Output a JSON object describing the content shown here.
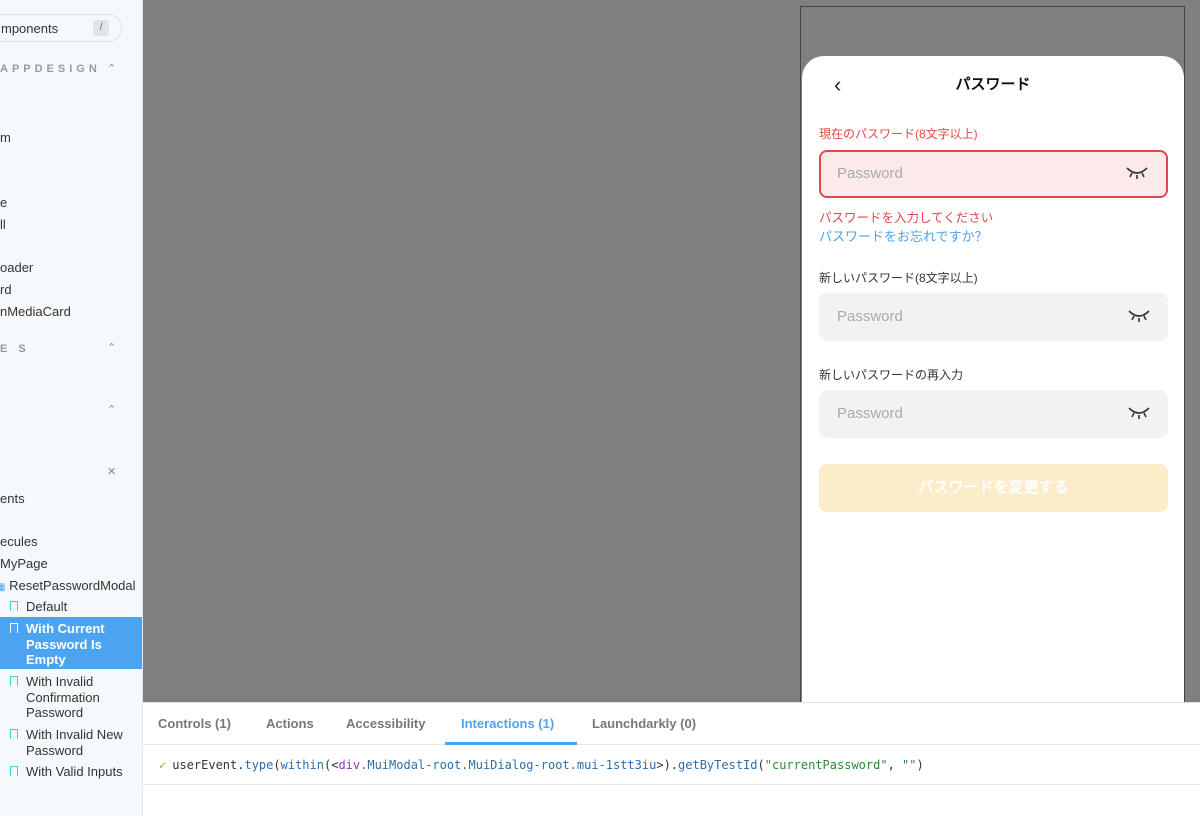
{
  "sidebar": {
    "search_placeholder": "mponents",
    "search_shortcut": "/",
    "section_appdesign": "APPDESIGN",
    "section_es": "E S",
    "items": [
      {
        "label": "m"
      },
      {
        "label": "e"
      },
      {
        "label": "ll"
      },
      {
        "label": "oader"
      },
      {
        "label": "rd"
      },
      {
        "label": "nMediaCard"
      },
      {
        "label": "ents"
      },
      {
        "label": "ecules"
      },
      {
        "label": "MyPage"
      },
      {
        "label": "ResetPasswordModal"
      }
    ],
    "stories": [
      {
        "label": "Default"
      },
      {
        "label": "With Current Password Is Empty",
        "selected": true
      },
      {
        "label": "With Invalid Confirmation Password"
      },
      {
        "label": "With Invalid New Password"
      },
      {
        "label": "With Valid Inputs"
      }
    ]
  },
  "modal": {
    "title": "パスワード",
    "current_label": "現在のパスワード(8文字以上)",
    "current_placeholder": "Password",
    "error_message": "パスワードを入力してください",
    "forgot_link": "パスワードをお忘れですか？",
    "new_label": "新しいパスワード(8文字以上)",
    "new_placeholder": "Password",
    "confirm_label": "新しいパスワードの再入力",
    "confirm_placeholder": "Password",
    "submit_label": "パスワードを変更する"
  },
  "panel": {
    "tabs": [
      "Controls (1)",
      "Actions",
      "Accessibility",
      "Interactions (1)",
      "Launchdarkly (0)"
    ],
    "active_tab": "Interactions (1)",
    "log": {
      "p1": "userEvent.",
      "fn": "type",
      "p2": "(",
      "within": "within",
      "p3": "(<",
      "tag": "div",
      "cls": ".MuiModal-root.MuiDialog-root.mui-1stt3iu",
      "p4": ">).",
      "getter": "getByTestId",
      "p5": "(",
      "arg": "\"currentPassword\"",
      "p6": ", ",
      "arg2": "\"\"",
      "p7": ")"
    }
  },
  "colors": {
    "accent": "#4ca3f0",
    "error": "#e04848",
    "submit_disabled": "#fbecca",
    "preview_bg": "#7f7f7f"
  }
}
